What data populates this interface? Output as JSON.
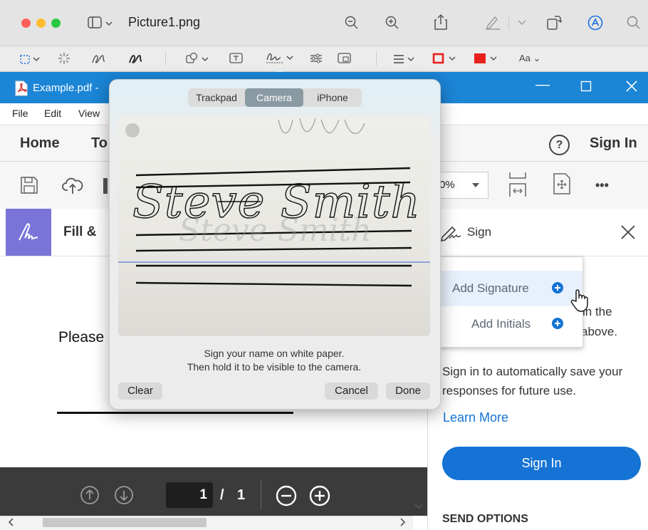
{
  "preview": {
    "title": "Picture1.png",
    "title_chevron": "⌄"
  },
  "acrobat": {
    "window_title": "Example.pdf -",
    "window_controls": {
      "minimize": "—",
      "maximize": "☐",
      "close": "✕"
    },
    "menu": [
      "File",
      "Edit",
      "View"
    ],
    "tabs": {
      "home": "Home",
      "tools": "To",
      "help_icon": "?",
      "sign_in": "Sign In"
    },
    "zoom_value": "0%",
    "more": "•••",
    "fill_label": "Fill &",
    "doc_text": "Please",
    "page_current": "1",
    "page_sep": "/",
    "page_total": "1"
  },
  "sign_panel": {
    "title": "Sign",
    "close": "✕",
    "menu": [
      {
        "label": "Add Signature"
      },
      {
        "label": "Add Initials"
      }
    ],
    "hidden_text_1": "in the",
    "hidden_text_2": "above.",
    "info": "Sign in to automatically save your responses for future use.",
    "learn_more": "Learn More",
    "sign_in_button": "Sign In",
    "send_options": "SEND OPTIONS"
  },
  "dialog": {
    "segments": [
      {
        "label": "Trackpad",
        "selected": false
      },
      {
        "label": "Camera",
        "selected": true
      },
      {
        "label": "iPhone",
        "selected": false
      }
    ],
    "signature_text": "Steve Smith",
    "instructions_line1": "Sign your name on white paper.",
    "instructions_line2": "Then hold it to be visible to the camera.",
    "clear": "Clear",
    "cancel": "Cancel",
    "done": "Done"
  },
  "colors": {
    "acrobat_blue": "#1b85d6",
    "sign_in_blue": "#1473d4",
    "fill_sign_purple": "#7b74d8",
    "traffic_red": "#fe5f57",
    "traffic_yellow": "#febc2e",
    "traffic_green": "#28c840",
    "markup_red": "#e8221b"
  }
}
